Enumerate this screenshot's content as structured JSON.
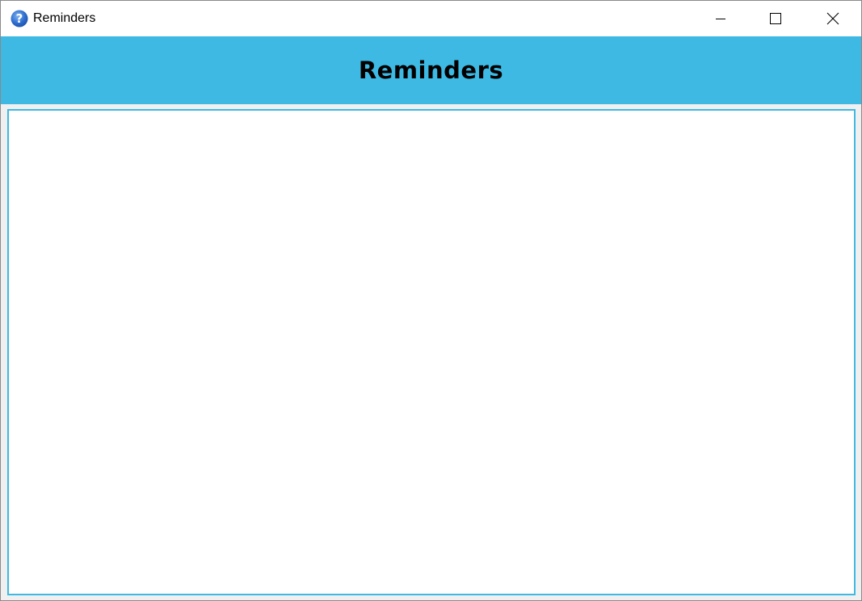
{
  "window": {
    "title": "Reminders",
    "app_icon": "help-question-icon"
  },
  "controls": {
    "minimize_icon": "minimize-icon",
    "maximize_icon": "maximize-icon",
    "close_icon": "close-icon"
  },
  "header": {
    "title": "Reminders",
    "background_color": "#3db9e3"
  },
  "reminders_list": {
    "items": []
  },
  "colors": {
    "accent": "#3db9e3"
  }
}
